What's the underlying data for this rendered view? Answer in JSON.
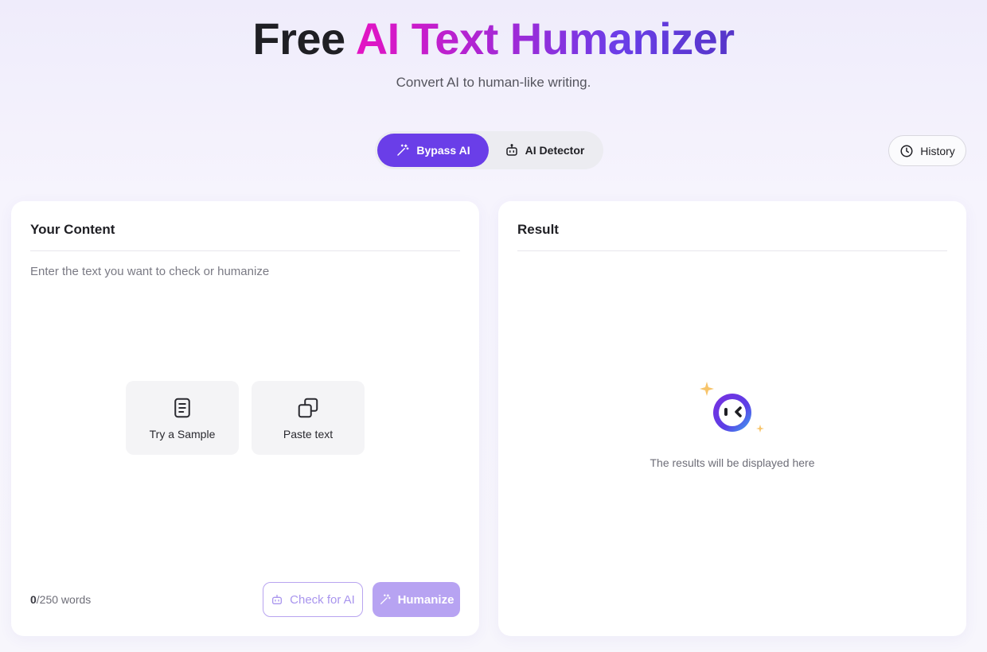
{
  "hero": {
    "title_plain": "Free",
    "title_gradient": "AI Text Humanizer",
    "subtitle": "Convert AI to human-like writing."
  },
  "mode_switch": {
    "tabs": [
      {
        "label": "Bypass AI",
        "icon": "magic-wand-icon",
        "active": true
      },
      {
        "label": "AI Detector",
        "icon": "robot-icon",
        "active": false
      }
    ]
  },
  "history": {
    "label": "History",
    "icon": "clock-icon"
  },
  "content_panel": {
    "title": "Your Content",
    "placeholder": "Enter the text you want to check or humanize",
    "sample_label": "Try a Sample",
    "paste_label": "Paste text",
    "word_count_current": "0",
    "word_count_suffix": "/250 words",
    "check_label": "Check for AI",
    "humanize_label": "Humanize"
  },
  "result_panel": {
    "title": "Result",
    "placeholder": "The results will be displayed here"
  },
  "colors": {
    "accent": "#6a3ee8",
    "accent_disabled": "#b7a3f2",
    "gradient_start": "#e414c3",
    "gradient_end": "#5535c8"
  }
}
